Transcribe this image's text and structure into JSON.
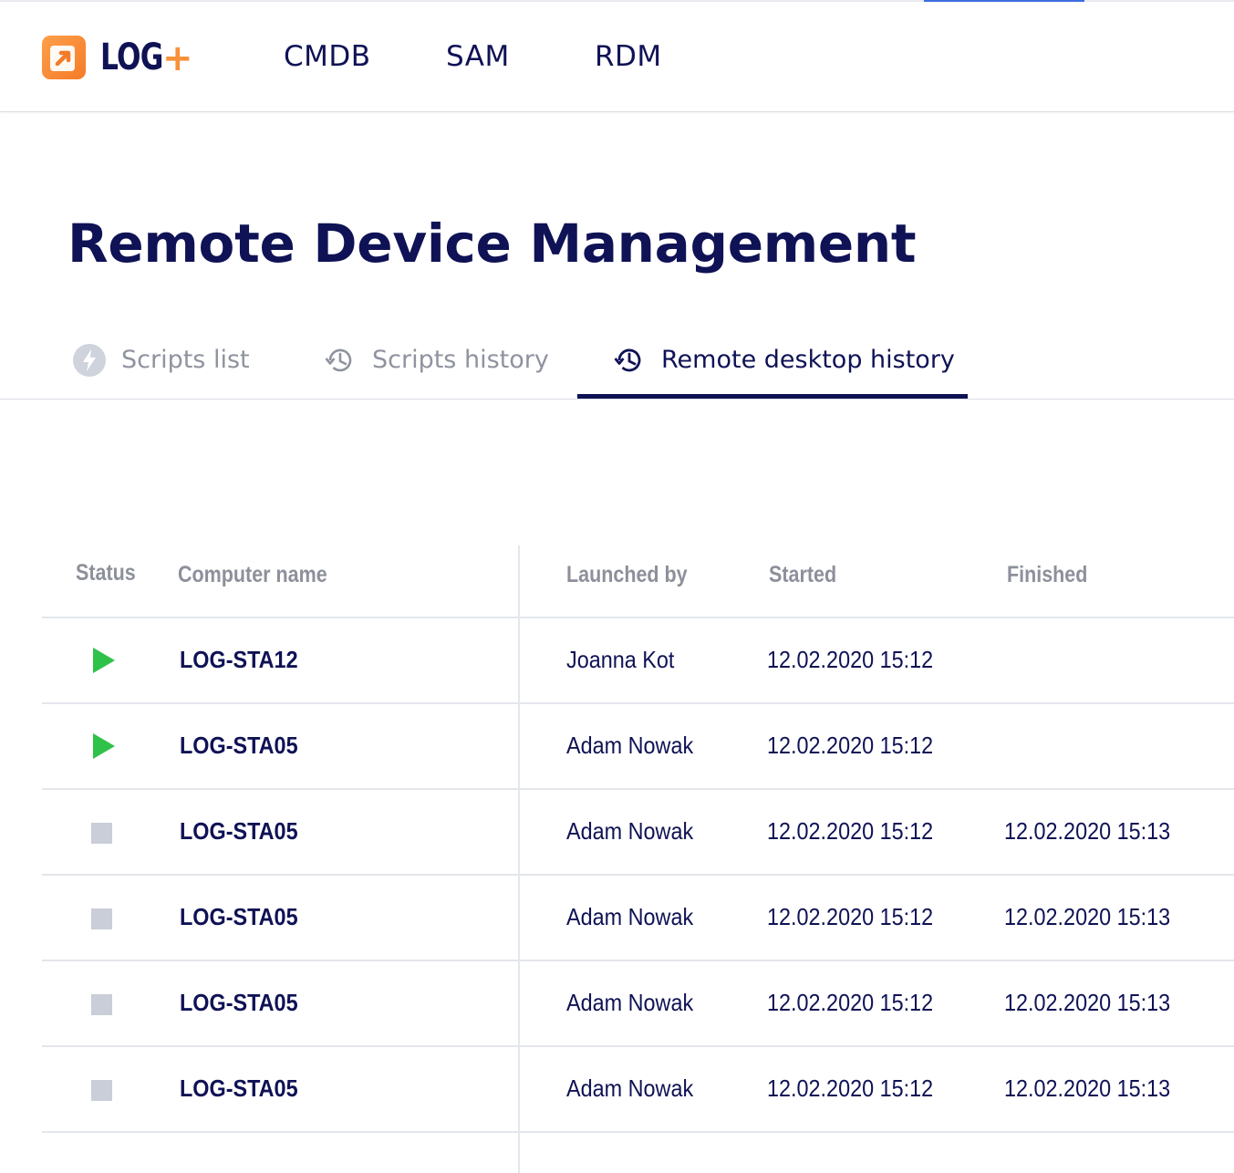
{
  "app": {
    "logo_text": "LOG",
    "logo_plus": "+",
    "nav": [
      {
        "label": "CMDB"
      },
      {
        "label": "SAM"
      },
      {
        "label": "RDM"
      }
    ]
  },
  "page": {
    "title": "Remote Device Management"
  },
  "tabs": [
    {
      "label": "Scripts list",
      "icon": "lightning-icon",
      "active": false
    },
    {
      "label": "Scripts history",
      "icon": "history-icon",
      "active": false
    },
    {
      "label": "Remote desktop history",
      "icon": "history-icon",
      "active": true
    }
  ],
  "table": {
    "columns": {
      "status": "Status",
      "computer_name": "Computer name",
      "launched_by": "Launched by",
      "started": "Started",
      "finished": "Finished"
    },
    "rows": [
      {
        "status": "running",
        "status_icon": "play-icon",
        "computer_name": "LOG-STA12",
        "launched_by": "Joanna Kot",
        "started": "12.02.2020 15:12",
        "finished": ""
      },
      {
        "status": "running",
        "status_icon": "play-icon",
        "computer_name": "LOG-STA05",
        "launched_by": "Adam Nowak",
        "started": "12.02.2020 15:12",
        "finished": ""
      },
      {
        "status": "stopped",
        "status_icon": "stop-icon",
        "computer_name": "LOG-STA05",
        "launched_by": "Adam Nowak",
        "started": "12.02.2020 15:12",
        "finished": "12.02.2020 15:13"
      },
      {
        "status": "stopped",
        "status_icon": "stop-icon",
        "computer_name": "LOG-STA05",
        "launched_by": "Adam Nowak",
        "started": "12.02.2020 15:12",
        "finished": "12.02.2020 15:13"
      },
      {
        "status": "stopped",
        "status_icon": "stop-icon",
        "computer_name": "LOG-STA05",
        "launched_by": "Adam Nowak",
        "started": "12.02.2020 15:12",
        "finished": "12.02.2020 15:13"
      },
      {
        "status": "stopped",
        "status_icon": "stop-icon",
        "computer_name": "LOG-STA05",
        "launched_by": "Adam Nowak",
        "started": "12.02.2020 15:12",
        "finished": "12.02.2020 15:13"
      }
    ]
  },
  "colors": {
    "brand_navy": "#0f1255",
    "brand_orange": "#f7923a",
    "running_green": "#2fc24a",
    "stopped_gray": "#c9ced8",
    "inactive_text": "#8f939f"
  }
}
